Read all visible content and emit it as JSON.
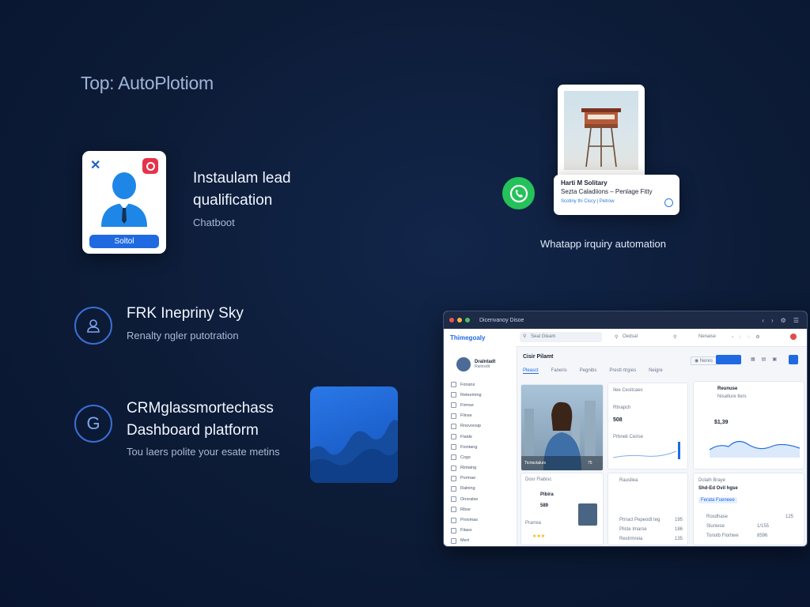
{
  "top_label": "Top: AutoPlotiom",
  "chatbot": {
    "title_line1": "Instaulam lead",
    "title_line2": "qualification",
    "subtitle": "Chatboot",
    "button_label": "Soltol"
  },
  "feature_sky": {
    "title": "FRK Inepriny Sky",
    "subtitle": "Renalty ngler putotration"
  },
  "feature_crm": {
    "title_line1": "CRMglassmortechass",
    "title_line2": "Dashboard platform",
    "subtitle": "Tou laers polite your esate metins"
  },
  "whatsapp": {
    "msg_line1": "Harti M Solitary",
    "msg_line2": "Sezta Caladiions – Penlage Fitty",
    "msg_line3": "Scotiny thi Ciscy  |  Petrow",
    "caption": "Whatapp irquiry automation"
  },
  "dashboard": {
    "window_title": "Dicenvanoy Disoe",
    "brand": "Thimegoaly",
    "search_placeholder": "Seal Gleam",
    "nav_item": "Oedsal",
    "nav_right": "Nenaise",
    "user_name": "Dralntadt",
    "user_role": "Raiinsdit",
    "page_title": "Cisir Pilamt",
    "tabs": [
      "Pleasct",
      "Faneris",
      "Pegnibs",
      "Prestl rtrgies",
      "Neigre"
    ],
    "new_button": "Neres",
    "sidebar_items": [
      "Fonans",
      "Reteeming",
      "Firmse",
      "Flinse",
      "Rnovonsip",
      "Flaide",
      "Fiontang",
      "Cogs",
      "Rintaing",
      "Pormae",
      "Ralning",
      "Onoralse",
      "Rbse",
      "Proomas",
      "Fitass",
      "Mert"
    ],
    "photo_caption": "Ticrtactalurs",
    "photo_count": "75",
    "card_a": {
      "title": "Ilee Cesitcaes",
      "label": "Rtnapch",
      "value": "508",
      "sub": "Prbnek Ceirse"
    },
    "card_b": {
      "title": "Reunuse",
      "subtitle": "Nisatlure tlers",
      "value": "$1,39"
    },
    "card_c": {
      "title": "Dosr Flabisc",
      "name": "Pibira",
      "value": "589",
      "sub": "Prarrea"
    },
    "card_d": {
      "title": "Rausllea",
      "rows": [
        {
          "label": "Ptrracl Pepeodt teg",
          "value": "195"
        },
        {
          "label": "Pliste Imarse",
          "value": "186"
        },
        {
          "label": "Restrmreia",
          "value": "135"
        }
      ]
    },
    "card_e": {
      "title": "Dclaih Braye",
      "subtitle": "Shd-Ed Ovil hgse",
      "tag": "Ferata Fueneee",
      "rows": [
        {
          "label": "Rosdhase",
          "value": "125"
        },
        {
          "label": "Sluniese",
          "value": "1/155"
        },
        {
          "label": "Tonotb Flortiwe",
          "value": "8596"
        }
      ]
    }
  },
  "colors": {
    "accent": "#1f6ae0",
    "background": "#0c1b36",
    "whatsapp": "#25c15a"
  }
}
